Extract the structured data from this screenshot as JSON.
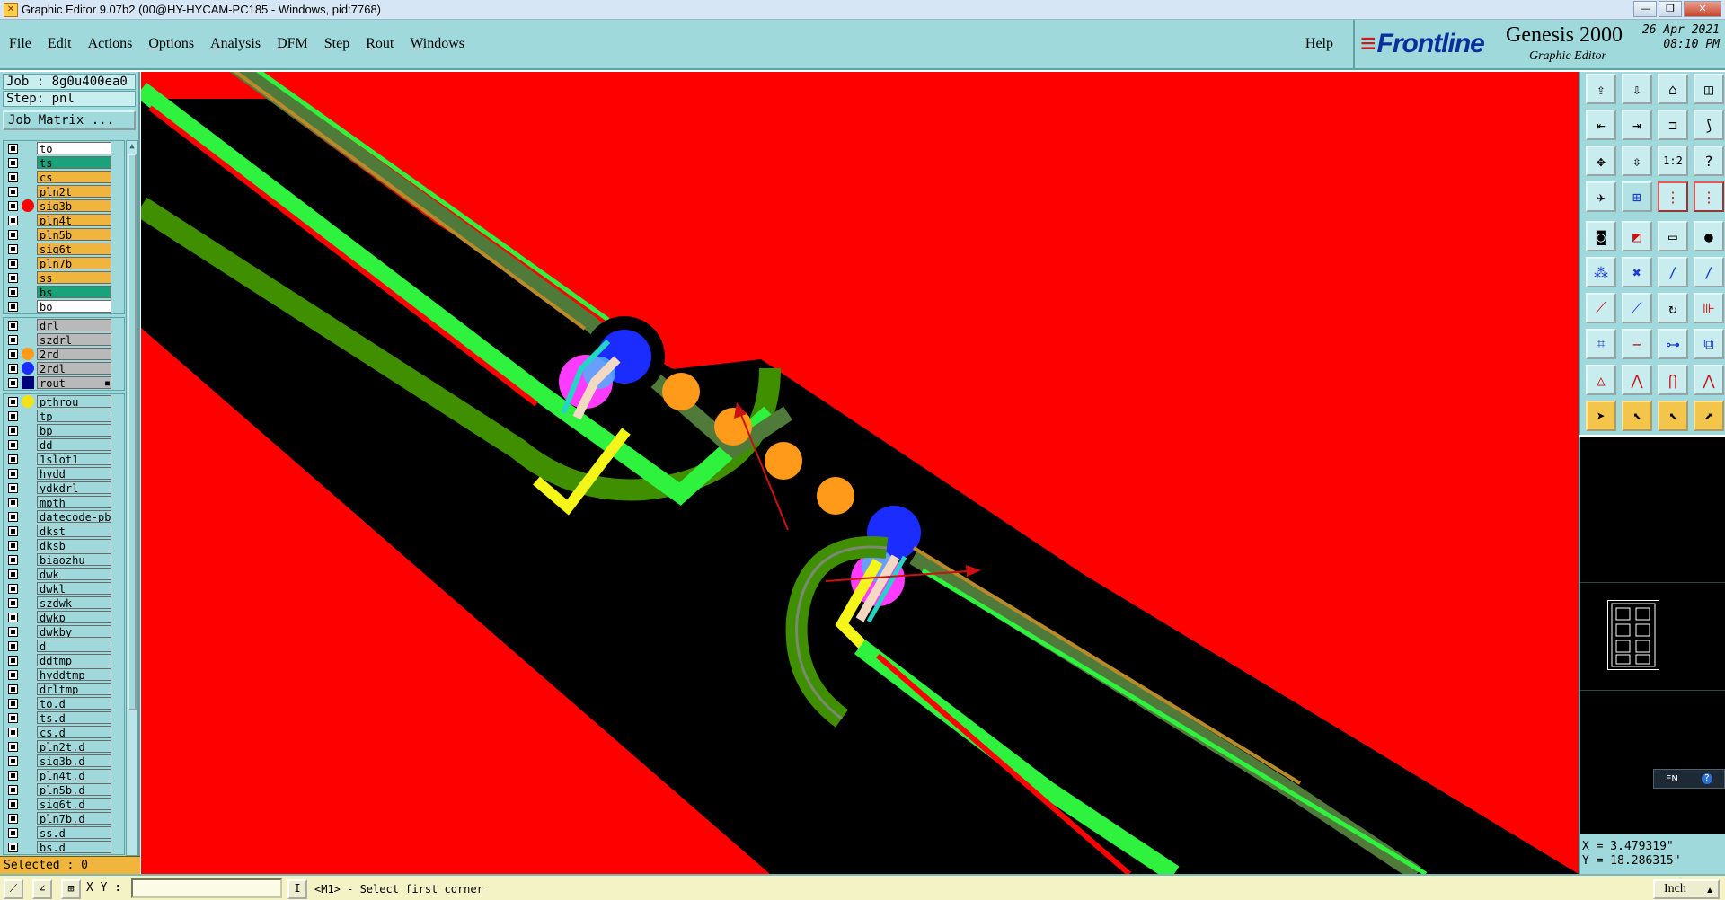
{
  "window": {
    "title": "Graphic Editor 9.07b2 (00@HY-HYCAM-PC185 - Windows, pid:7768)",
    "minimize": "—",
    "maximize": "❐",
    "close": "✕"
  },
  "menu": {
    "items": [
      "File",
      "Edit",
      "Actions",
      "Options",
      "Analysis",
      "DFM",
      "Step",
      "Rout",
      "Windows"
    ],
    "help": "Help"
  },
  "brand": {
    "logo": "Frontline",
    "product": "Genesis 2000",
    "subtitle": "Graphic Editor",
    "date": "26 Apr 2021",
    "time": "08:10 PM"
  },
  "job": {
    "job_line": "Job : 8g0u400ea0",
    "step_line": "Step: pnl",
    "matrix_button": "Job Matrix ..."
  },
  "layers": {
    "group1": [
      {
        "name": "to",
        "color": "#ffffff"
      },
      {
        "name": "ts",
        "color": "#1aa37a"
      },
      {
        "name": "cs",
        "color": "#f0b53d"
      },
      {
        "name": "pln2t",
        "color": "#f0b53d"
      },
      {
        "name": "sig3b",
        "color": "#f0b53d",
        "marker": "#ff0000"
      },
      {
        "name": "pln4t",
        "color": "#f0b53d"
      },
      {
        "name": "pln5b",
        "color": "#f0b53d"
      },
      {
        "name": "sig6t",
        "color": "#f0b53d"
      },
      {
        "name": "pln7b",
        "color": "#f0b53d"
      },
      {
        "name": "ss",
        "color": "#f0b53d"
      },
      {
        "name": "bs",
        "color": "#1aa37a"
      },
      {
        "name": "bo",
        "color": "#ffffff"
      }
    ],
    "group2": [
      {
        "name": "drl",
        "color": "#b9b9b9"
      },
      {
        "name": "szdrl",
        "color": "#b9b9b9"
      },
      {
        "name": "2rd",
        "color": "#b9b9b9",
        "marker": "#ff9a1a"
      },
      {
        "name": "2rdl",
        "color": "#b9b9b9",
        "marker": "#1a2cff"
      },
      {
        "name": "rout",
        "color": "#b9b9b9",
        "marker": "#3f8f00",
        "swatch": "#00007a"
      }
    ],
    "group3": [
      {
        "name": "pthrou",
        "color": "#9fd9dc",
        "marker": "#f5e11a"
      },
      {
        "name": "tp",
        "color": "#9fd9dc"
      },
      {
        "name": "bp",
        "color": "#9fd9dc"
      },
      {
        "name": "dd",
        "color": "#9fd9dc"
      },
      {
        "name": "1slot1",
        "color": "#9fd9dc"
      },
      {
        "name": "hydd",
        "color": "#9fd9dc"
      },
      {
        "name": "ydkdrl",
        "color": "#9fd9dc"
      },
      {
        "name": "mpth",
        "color": "#9fd9dc"
      },
      {
        "name": "datecode-pbe",
        "color": "#9fd9dc"
      },
      {
        "name": "dkst",
        "color": "#9fd9dc"
      },
      {
        "name": "dksb",
        "color": "#9fd9dc"
      },
      {
        "name": "biaozhu",
        "color": "#9fd9dc"
      },
      {
        "name": "dwk",
        "color": "#9fd9dc"
      },
      {
        "name": "dwkl",
        "color": "#9fd9dc"
      },
      {
        "name": "szdwk",
        "color": "#9fd9dc"
      },
      {
        "name": "dwkp",
        "color": "#9fd9dc"
      },
      {
        "name": "dwkby",
        "color": "#9fd9dc"
      },
      {
        "name": "d",
        "color": "#9fd9dc"
      },
      {
        "name": "ddtmp",
        "color": "#9fd9dc"
      },
      {
        "name": "hyddtmp",
        "color": "#9fd9dc"
      },
      {
        "name": "drltmp",
        "color": "#9fd9dc"
      },
      {
        "name": "to.d",
        "color": "#9fd9dc"
      },
      {
        "name": "ts.d",
        "color": "#9fd9dc"
      },
      {
        "name": "cs.d",
        "color": "#9fd9dc"
      },
      {
        "name": "pln2t.d",
        "color": "#9fd9dc"
      },
      {
        "name": "sig3b.d",
        "color": "#9fd9dc"
      },
      {
        "name": "pln4t.d",
        "color": "#9fd9dc"
      },
      {
        "name": "pln5b.d",
        "color": "#9fd9dc"
      },
      {
        "name": "sig6t.d",
        "color": "#9fd9dc"
      },
      {
        "name": "pln7b.d",
        "color": "#9fd9dc"
      },
      {
        "name": "ss.d",
        "color": "#9fd9dc"
      },
      {
        "name": "bs.d",
        "color": "#9fd9dc"
      }
    ]
  },
  "selected": "Selected : 0",
  "toolbox": {
    "icons": [
      "view-home-icon",
      "view-save-icon",
      "house-icon",
      "split-view-icon",
      "pan-left-icon",
      "pan-right-icon",
      "zoom-out-icon",
      "zoom-reset-icon",
      "fit-screen-icon",
      "zoom-extents-icon",
      "scale-1-2-icon",
      "help-icon",
      "helicopter-icon",
      "grid-icon",
      "snap-icon",
      "adjust-icon"
    ],
    "tools": [
      "snapshot-tool-icon",
      "edit-shape-icon",
      "ruler-icon",
      "pad-tool-icon",
      "node-tool-icon",
      "cross-tool-icon",
      "point-tool-icon",
      "move-point-icon",
      "line-tool-icon",
      "draw-line-icon",
      "arc-tool-icon",
      "measure-icon",
      "route-tool-icon",
      "cut-line-icon",
      "resize-tool-icon",
      "copy-tool-icon",
      "triangle-tool-icon",
      "polygon-tool-icon",
      "arch-tool-icon",
      "peak-tool-icon",
      "select-arrow-icon",
      "select-box-icon",
      "select-point-icon",
      "select-route-icon"
    ],
    "scale_label": "1:2",
    "help_label": "?"
  },
  "ime": {
    "lang": "EN",
    "help": "?"
  },
  "coords": {
    "x": "X = 3.479319\"",
    "y": "Y = 18.286315\""
  },
  "status": {
    "xy_label": "X Y :",
    "xy_value": "",
    "prompt": "<M1> - Select first corner",
    "units": "Inch"
  },
  "colors": {
    "background": "#ff0000",
    "copper_green": "#2ff23f",
    "dark_green": "#3f8f00",
    "khaki": "#9a7a3a",
    "blue_pad": "#1a2cff",
    "magenta_pad": "#ff3bff",
    "orange_hole": "#ff9a1a",
    "yellow_outline": "#f5f51a",
    "cyan_ring": "#22d5c5",
    "annotation_arrow": "#cc1111"
  }
}
